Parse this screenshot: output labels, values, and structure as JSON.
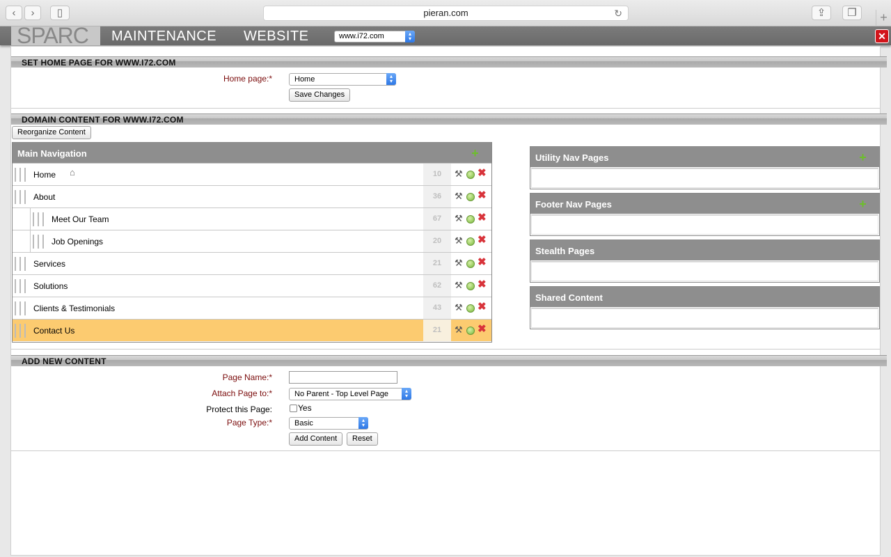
{
  "browser": {
    "url": "pieran.com",
    "back_glyph": "‹",
    "forward_glyph": "›",
    "sidebar_glyph": "▯",
    "reload_glyph": "↻",
    "share_glyph": "⇪",
    "tabs_glyph": "❐",
    "newtab_glyph": "+"
  },
  "appbar": {
    "logo": "SPARC",
    "title_1": "MAINTENANCE",
    "title_2": "WEBSITE",
    "site_selected": "www.i72.com",
    "close_glyph": "✕"
  },
  "home_section": {
    "heading": "SET HOME PAGE FOR WWW.I72.COM",
    "home_label": "Home page:*",
    "home_value": "Home",
    "save_label": "Save Changes"
  },
  "domain_section": {
    "heading": "DOMAIN CONTENT FOR WWW.I72.COM",
    "reorganize_label": "Reorganize Content"
  },
  "main_nav": {
    "title": "Main Navigation",
    "items": [
      {
        "label": "Home",
        "count": "10",
        "level": 0
      },
      {
        "label": "About",
        "count": "36",
        "level": 0
      },
      {
        "label": "Meet Our Team",
        "count": "67",
        "level": 1
      },
      {
        "label": "Job Openings",
        "count": "20",
        "level": 1
      },
      {
        "label": "Services",
        "count": "21",
        "level": 0
      },
      {
        "label": "Solutions",
        "count": "62",
        "level": 0
      },
      {
        "label": "Clients & Testimonials",
        "count": "43",
        "level": 0
      },
      {
        "label": "Contact Us",
        "count": "21",
        "level": 0,
        "selected": true
      }
    ]
  },
  "side_panels": {
    "utility": "Utility Nav Pages",
    "footer": "Footer Nav Pages",
    "stealth": "Stealth Pages",
    "shared": "Shared Content"
  },
  "add_section": {
    "heading": "ADD NEW CONTENT",
    "page_name_label": "Page Name:*",
    "page_name_value": "",
    "attach_label": "Attach Page to:*",
    "attach_value": "No Parent - Top Level Page",
    "protect_label": "Protect this Page:",
    "protect_option": "Yes",
    "type_label": "Page Type:*",
    "type_value": "Basic",
    "add_label": "Add Content",
    "reset_label": "Reset"
  },
  "colors": {
    "selected_row": "#fccb70",
    "panel_header": "#8e8e8e",
    "required_label": "#7a0b0b",
    "close_button": "#d2141a"
  }
}
